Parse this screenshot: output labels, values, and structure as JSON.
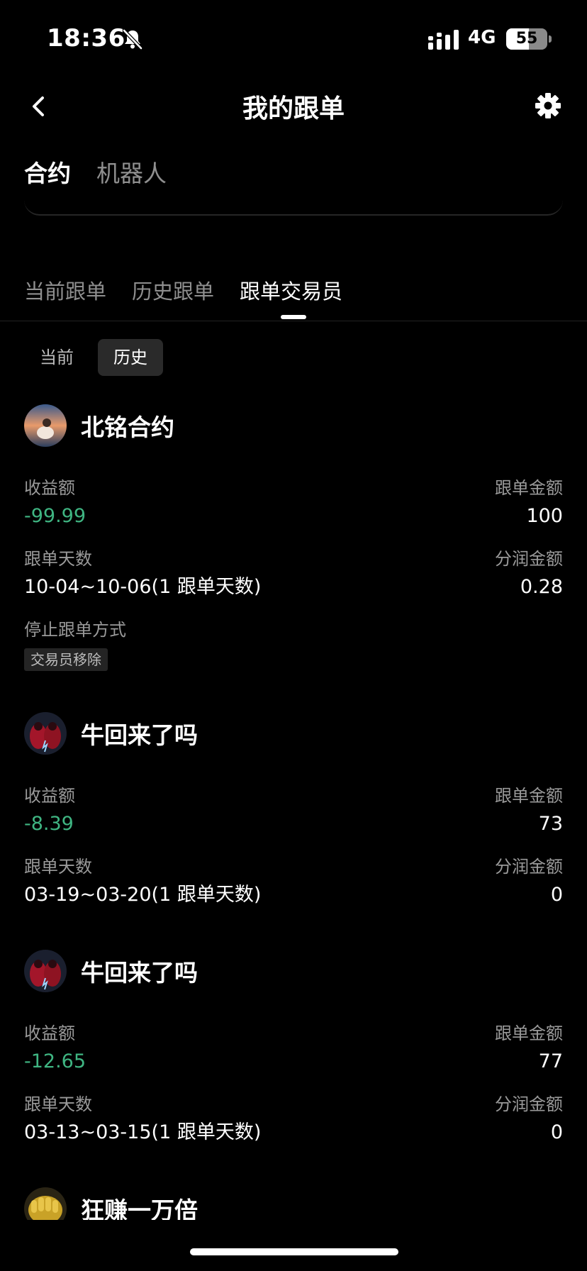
{
  "status": {
    "time": "18:36",
    "network": "4G",
    "battery": "55",
    "battery_level": 0.55
  },
  "nav": {
    "title": "我的跟单"
  },
  "type_tabs": [
    {
      "label": "合约"
    },
    {
      "label": "机器人"
    }
  ],
  "main_tabs": [
    {
      "label": "当前跟单"
    },
    {
      "label": "历史跟单"
    },
    {
      "label": "跟单交易员"
    }
  ],
  "segment": [
    {
      "label": "当前"
    },
    {
      "label": "历史"
    }
  ],
  "entries": [
    {
      "name": "北铭合约",
      "pnl_label": "收益额",
      "pnl": "-99.99",
      "amount_label": "跟单金额",
      "amount": "100",
      "days_label": "跟单天数",
      "days": "10-04~10-06(1 跟单天数)",
      "share_label": "分润金额",
      "share": "0.28",
      "stop_label": "停止跟单方式",
      "stop_tag": "交易员移除"
    },
    {
      "name": "牛回来了吗",
      "pnl_label": "收益额",
      "pnl": "-8.39",
      "amount_label": "跟单金额",
      "amount": "73",
      "days_label": "跟单天数",
      "days": "03-19~03-20(1 跟单天数)",
      "share_label": "分润金额",
      "share": "0"
    },
    {
      "name": "牛回来了吗",
      "pnl_label": "收益额",
      "pnl": "-12.65",
      "amount_label": "跟单金额",
      "amount": "77",
      "days_label": "跟单天数",
      "days": "03-13~03-15(1 跟单天数)",
      "share_label": "分润金额",
      "share": "0"
    },
    {
      "name": "狂赚一万倍"
    }
  ],
  "colors": {
    "background": "#000000",
    "profit_negative": "#3fb582",
    "muted_text": "#9a9a9a"
  }
}
